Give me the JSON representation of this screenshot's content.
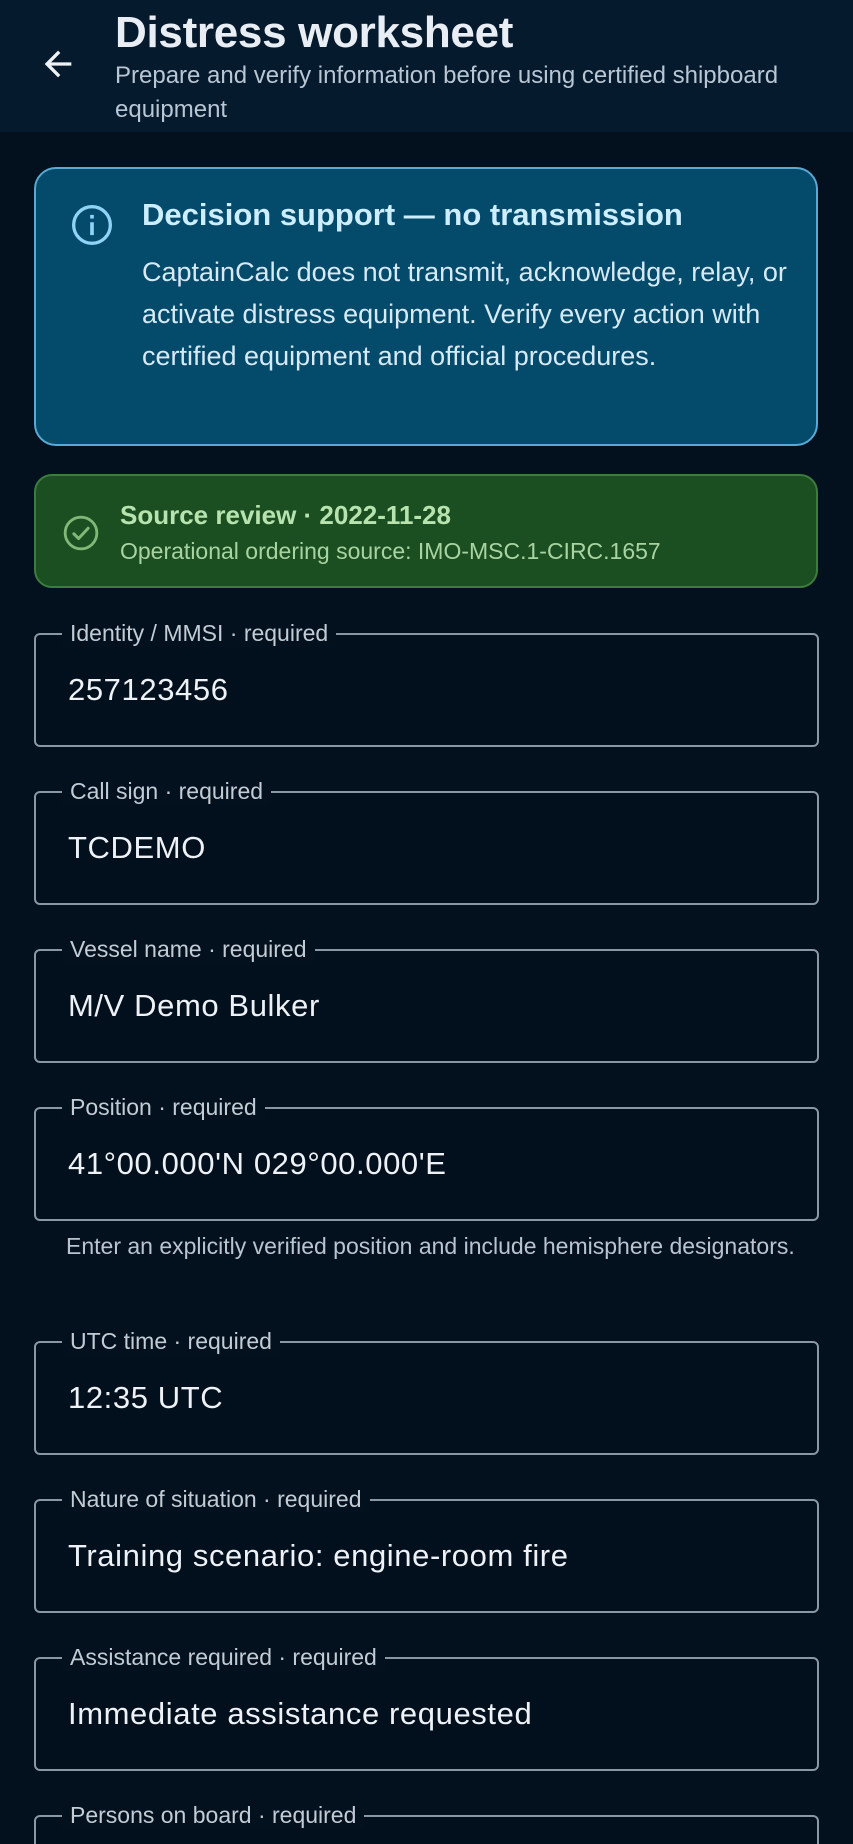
{
  "header": {
    "title": "Distress worksheet",
    "subtitle": "Prepare and verify information before using certified shipboard equipment",
    "back_icon": "arrow-left-icon"
  },
  "notice": {
    "icon": "info-icon",
    "title": "Decision support — no transmission",
    "body": "CaptainCalc does not transmit, acknowledge, relay, or activate distress equipment. Verify every action with certified equipment and official procedures."
  },
  "source_review": {
    "icon": "check-circle-icon",
    "title": "Source review · 2022-11-28",
    "subtitle": "Operational ordering source: IMO-MSC.1-CIRC.1657"
  },
  "fields": [
    {
      "label": "Identity / MMSI · required",
      "value": "257123456"
    },
    {
      "label": "Call sign · required",
      "value": "TCDEMO"
    },
    {
      "label": "Vessel name · required",
      "value": "M/V Demo Bulker"
    },
    {
      "label": "Position · required",
      "value": "41°00.000'N 029°00.000'E",
      "helper": "Enter an explicitly verified position and include hemisphere designators."
    },
    {
      "label": "UTC time · required",
      "value": "12:35 UTC"
    },
    {
      "label": "Nature of situation · required",
      "value": "Training scenario: engine-room fire"
    },
    {
      "label": "Assistance required · required",
      "value": "Immediate assistance requested"
    },
    {
      "label": "Persons on board · required",
      "value": ""
    }
  ],
  "colors": {
    "background": "#03111f",
    "topbar": "#061a2d",
    "info_card": "#044a6a",
    "info_border": "#5aa9d4",
    "success_card": "#1b4f21",
    "success_border": "#3d7d3b",
    "field_border": "#8a98a6"
  }
}
